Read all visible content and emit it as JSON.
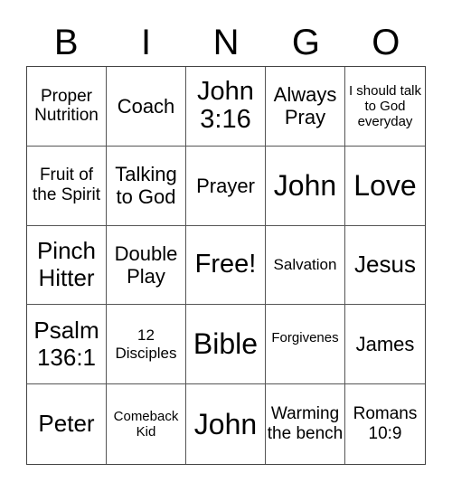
{
  "header": [
    "B",
    "I",
    "N",
    "G",
    "O"
  ],
  "cells": [
    "Proper Nutrition",
    "Coach",
    "John 3:16",
    "Always Pray",
    "I should talk to God everyday",
    "Fruit of the Spirit",
    "Talking to God",
    "Prayer",
    "John",
    "Love",
    "Pinch Hitter",
    "Double Play",
    "Free!",
    "Salvation",
    "Jesus",
    "Psalm 136:1",
    "12 Disciples",
    "Bible",
    "Forgivenes",
    "James",
    "Peter",
    "Comeback Kid",
    "John",
    "Warming the bench",
    "Romans 10:9"
  ]
}
